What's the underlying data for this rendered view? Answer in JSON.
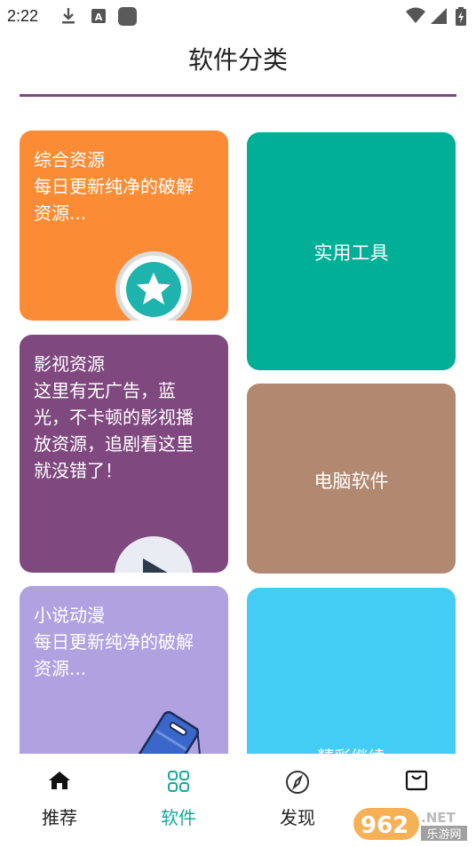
{
  "status_bar": {
    "time": "2:22",
    "icons": [
      "download-icon",
      "notification-a-icon",
      "app-square-icon",
      "wifi-icon",
      "signal-icon",
      "battery-charging-icon"
    ]
  },
  "header": {
    "title": "软件分类"
  },
  "cards": {
    "comprehensive": {
      "title": "综合资源",
      "desc": "每日更新纯净的破解资源...",
      "color": "#fb8c35",
      "icon": "star-badge-icon"
    },
    "tools": {
      "label": "实用工具",
      "color": "#00af96"
    },
    "video": {
      "title": "影视资源",
      "desc": "这里有无广告，蓝光，不卡顿的影视播放资源，追剧看这里就没错了！",
      "color": "#7f497f",
      "icon": "play-badge-icon"
    },
    "pc": {
      "label": "电脑软件",
      "color": "#b18870"
    },
    "novel": {
      "title": "小说动漫",
      "desc": "每日更新纯净的破解资源...",
      "color": "#b0a2e0",
      "icon": "phone-illustration-icon"
    },
    "more": {
      "label": "精彩继续",
      "color": "#44cdf4"
    }
  },
  "nav": {
    "items": [
      {
        "label": "推荐",
        "icon": "home-icon",
        "active": false
      },
      {
        "label": "软件",
        "icon": "grid-icon",
        "active": true
      },
      {
        "label": "发现",
        "icon": "compass-icon",
        "active": false
      },
      {
        "label": "",
        "icon": "shop-bag-icon",
        "active": false
      }
    ],
    "active_color": "#17a99b"
  },
  "watermark": {
    "number": "962",
    "suffix": ".NET",
    "cn": "乐游网"
  }
}
